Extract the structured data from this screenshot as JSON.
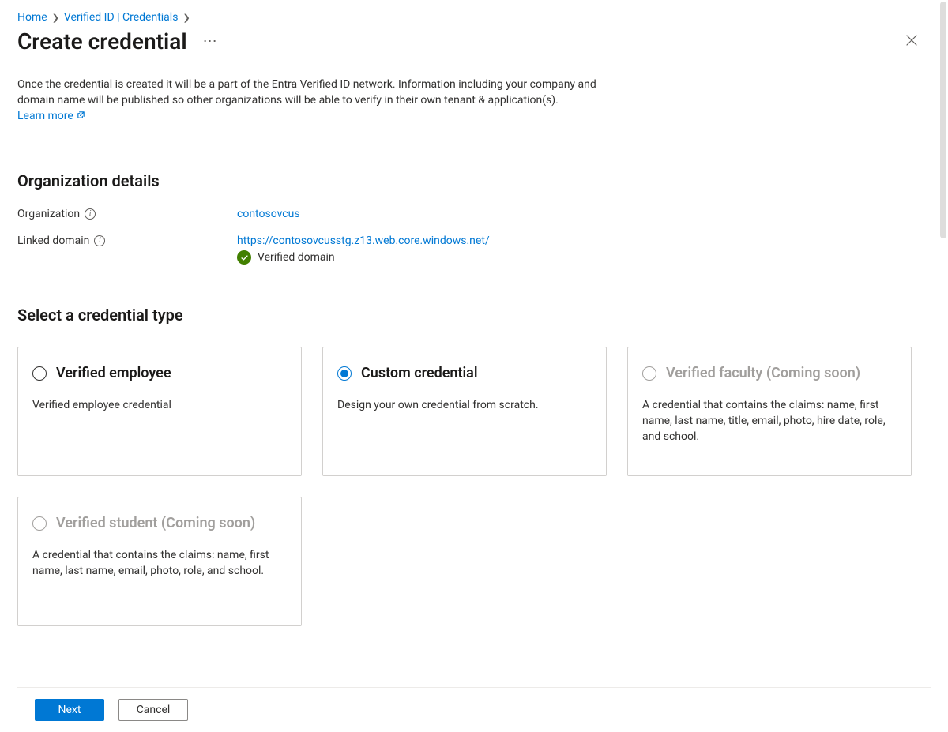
{
  "breadcrumbs": {
    "home": "Home",
    "verified_id": "Verified ID | Credentials"
  },
  "title": "Create credential",
  "intro_text": "Once the credential is created it will be a part of the Entra Verified ID network. Information including your company and domain name will be published so other organizations will be able to verify in their own tenant & application(s).",
  "learn_more": "Learn more",
  "org_section_heading": "Organization details",
  "org": {
    "label_org": "Organization",
    "value_org": "contosovcus",
    "label_domain": "Linked domain",
    "value_domain": "https://contosovcusstg.z13.web.core.windows.net/",
    "verified_text": "Verified domain"
  },
  "cred_section_heading": "Select a credential type",
  "cards": {
    "c0": {
      "title": "Verified employee",
      "desc": "Verified employee credential"
    },
    "c1": {
      "title": "Custom credential",
      "desc": "Design your own credential from scratch."
    },
    "c2": {
      "title": "Verified faculty (Coming soon)",
      "desc": "A credential that contains the claims: name, first name, last name, title, email, photo, hire date, role, and school."
    },
    "c3": {
      "title": "Verified student (Coming soon)",
      "desc": "A credential that contains the claims: name, first name, last name, email, photo, role, and school."
    }
  },
  "footer": {
    "next": "Next",
    "cancel": "Cancel"
  }
}
